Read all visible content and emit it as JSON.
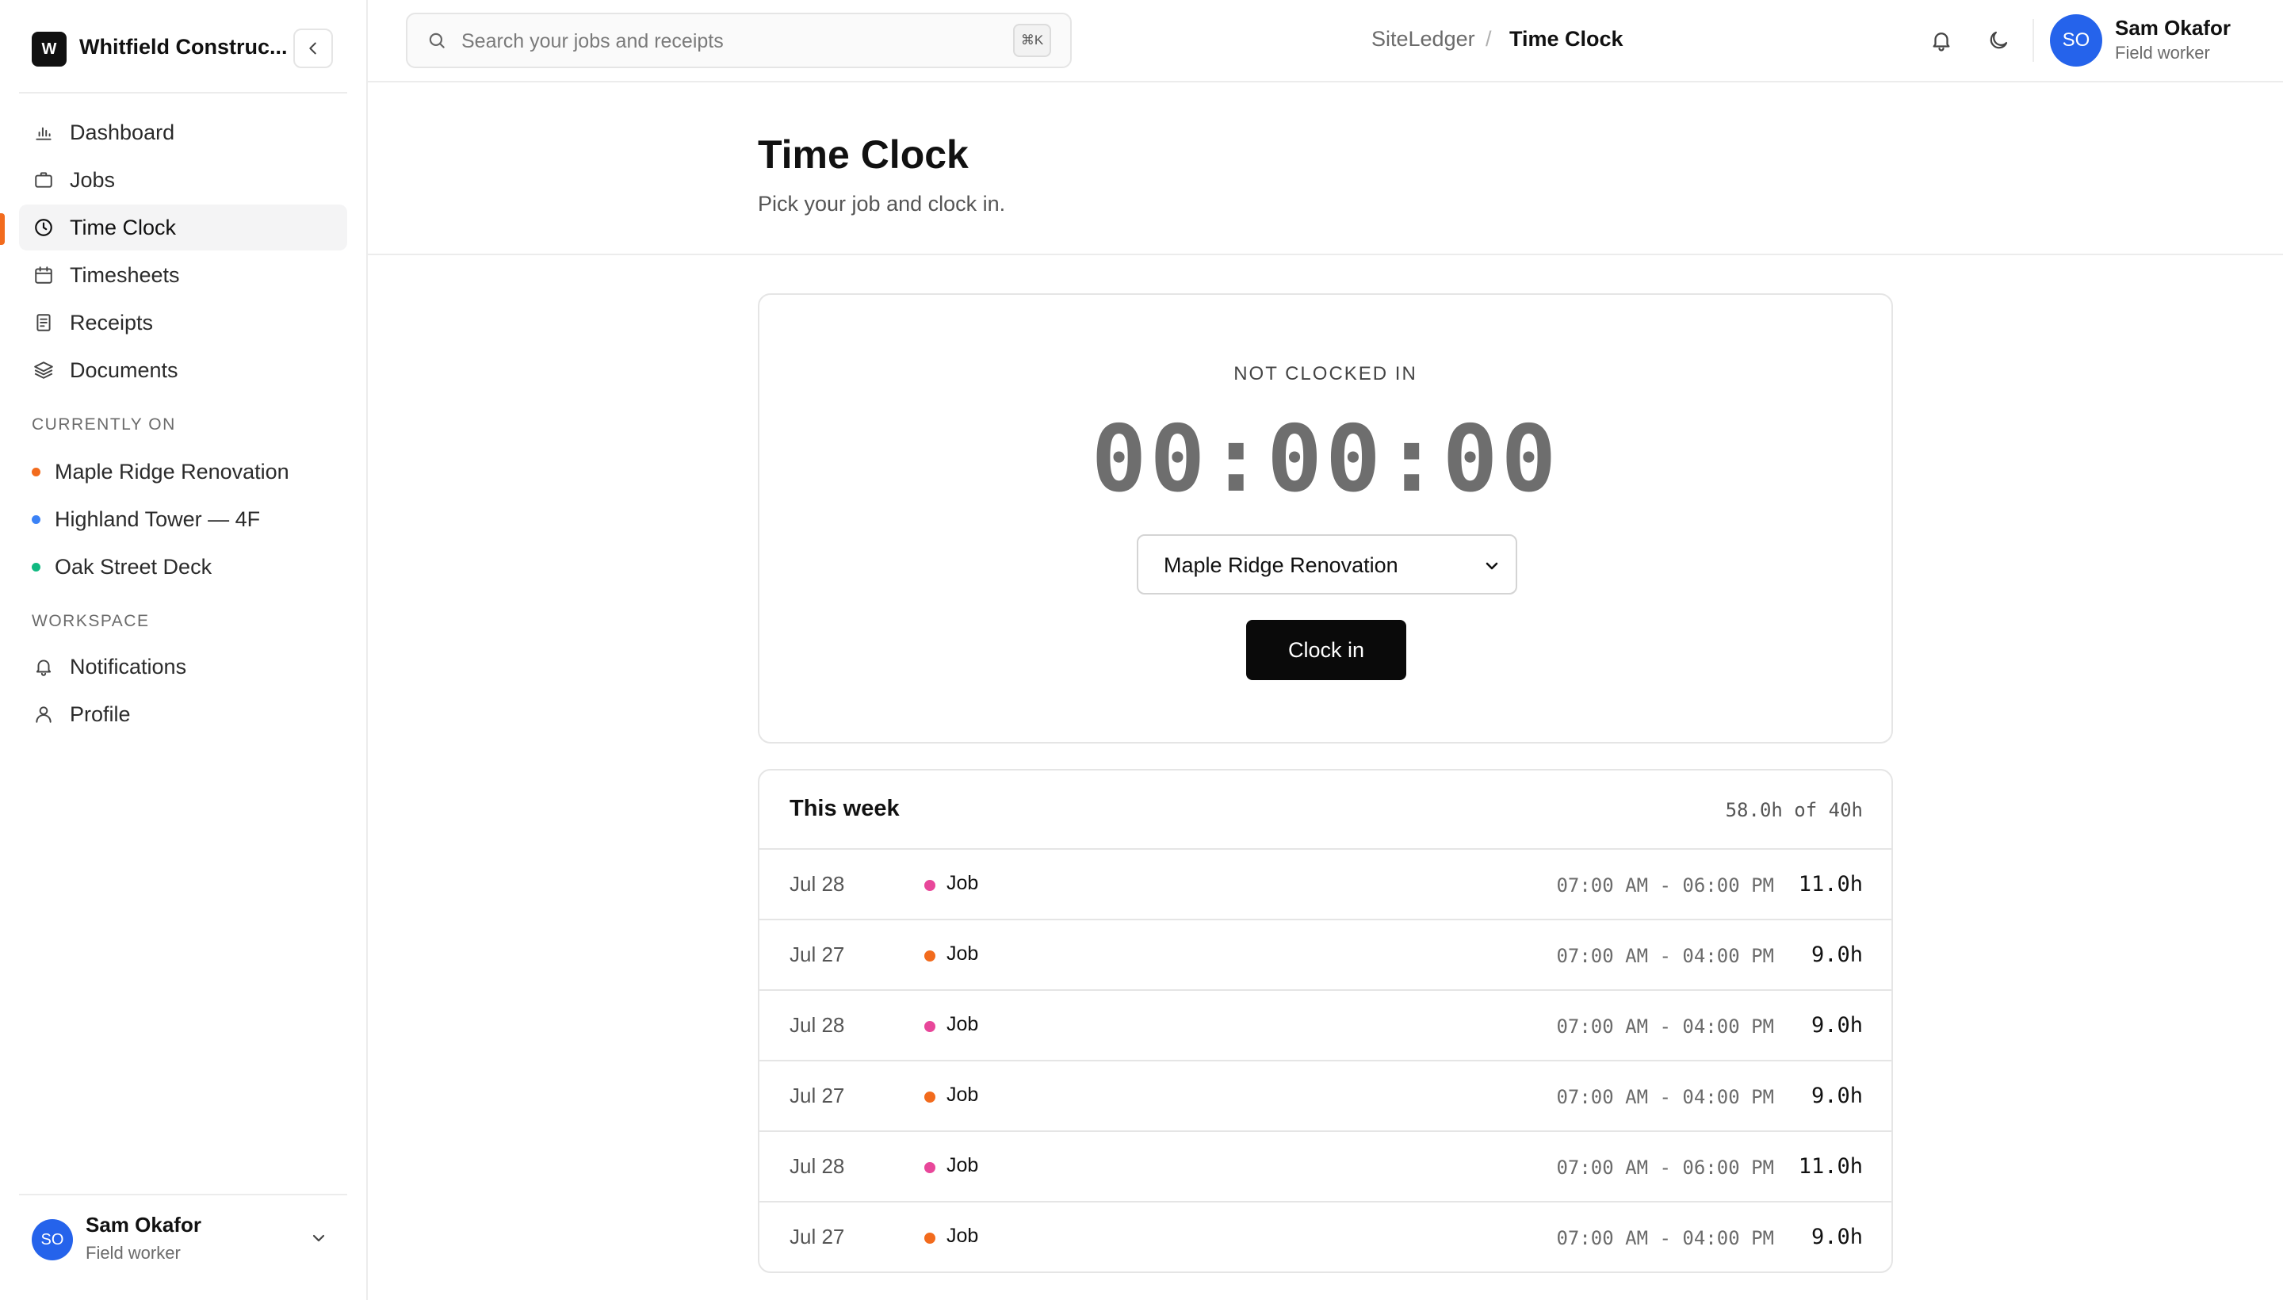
{
  "sidebar": {
    "brand": {
      "initial": "W",
      "name": "Whitfield Construc..."
    },
    "nav": [
      {
        "label": "Dashboard",
        "icon": "bar-chart-icon"
      },
      {
        "label": "Jobs",
        "icon": "briefcase-icon"
      },
      {
        "label": "Time Clock",
        "icon": "clock-icon",
        "active": true
      },
      {
        "label": "Timesheets",
        "icon": "calendar-icon"
      },
      {
        "label": "Receipts",
        "icon": "receipt-icon"
      },
      {
        "label": "Documents",
        "icon": "layers-icon"
      }
    ],
    "currently_on_heading": "CURRENTLY ON",
    "projects": [
      {
        "label": "Maple Ridge Renovation",
        "color": "#f26b1d"
      },
      {
        "label": "Highland Tower — 4F",
        "color": "#3b82f6"
      },
      {
        "label": "Oak Street Deck",
        "color": "#10b981"
      }
    ],
    "workspace_heading": "WORKSPACE",
    "workspace": [
      {
        "label": "Notifications",
        "icon": "bell-icon"
      },
      {
        "label": "Profile",
        "icon": "user-icon"
      }
    ],
    "user": {
      "initials": "SO",
      "name": "Sam Okafor",
      "role": "Field worker"
    }
  },
  "header": {
    "search_placeholder": "Search your jobs and receipts",
    "search_shortcut": "⌘K",
    "breadcrumb_root": "SiteLedger",
    "breadcrumb_sep": "/",
    "breadcrumb_current": "Time Clock",
    "user": {
      "initials": "SO",
      "name": "Sam Okafor",
      "role": "Field worker"
    }
  },
  "page": {
    "title": "Time Clock",
    "subtitle": "Pick your job and clock in."
  },
  "clock": {
    "status": "NOT CLOCKED IN",
    "time": "00:00:00",
    "selected_job": "Maple Ridge Renovation",
    "button_label": "Clock in"
  },
  "week": {
    "title": "This week",
    "total": "58.0h of 40h",
    "rows": [
      {
        "date": "Jul 28",
        "job": "Job",
        "range": "07:00 AM - 06:00 PM",
        "hours": "11.0h",
        "color": "#e8479a"
      },
      {
        "date": "Jul 27",
        "job": "Job",
        "range": "07:00 AM - 04:00 PM",
        "hours": "9.0h",
        "color": "#f26b1d"
      },
      {
        "date": "Jul 28",
        "job": "Job",
        "range": "07:00 AM - 04:00 PM",
        "hours": "9.0h",
        "color": "#e8479a"
      },
      {
        "date": "Jul 27",
        "job": "Job",
        "range": "07:00 AM - 04:00 PM",
        "hours": "9.0h",
        "color": "#f26b1d"
      },
      {
        "date": "Jul 28",
        "job": "Job",
        "range": "07:00 AM - 06:00 PM",
        "hours": "11.0h",
        "color": "#e8479a"
      },
      {
        "date": "Jul 27",
        "job": "Job",
        "range": "07:00 AM - 04:00 PM",
        "hours": "9.0h",
        "color": "#f26b1d"
      }
    ]
  },
  "colors": {
    "accent": "#f26b1d",
    "avatar": "#2563eb",
    "primary_button": "#0a0a0a"
  }
}
